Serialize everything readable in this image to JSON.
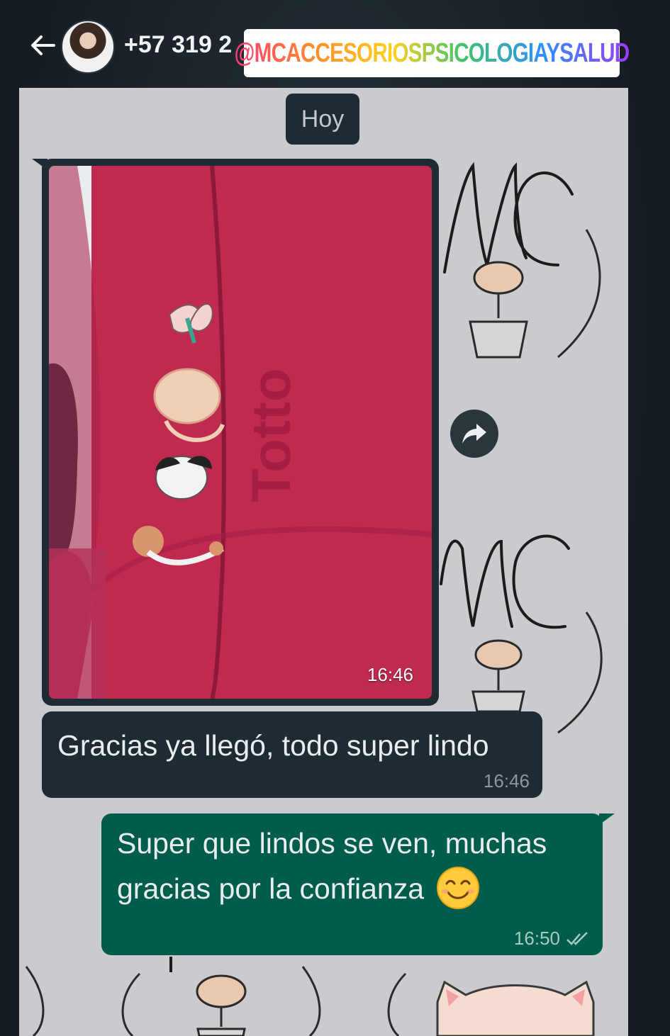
{
  "header": {
    "contact_name": "+57 319 2",
    "instagram_handle": "@MCACCESORIOSPSICOLOGIAYSALUD",
    "back_icon": "arrow-left-icon",
    "avatar_icon": "profile-avatar"
  },
  "chat": {
    "date_chip": "Hoy",
    "messages": [
      {
        "type": "image",
        "direction": "incoming",
        "time": "16:46",
        "icon": "photo-pink-backpack-with-pins"
      },
      {
        "type": "text",
        "direction": "incoming",
        "text": "Gracias ya llegó, todo super lindo",
        "time": "16:46"
      },
      {
        "type": "text",
        "direction": "outgoing",
        "text": "Super que lindos se ven, muchas gracias por la confianza",
        "emoji": "smiling-face-icon",
        "time": "16:50",
        "status_icon": "double-check-icon"
      }
    ],
    "forward_icon": "forward-share-icon",
    "wallpaper_text": "MC"
  },
  "colors": {
    "incoming_bubble": "#1f2b32",
    "outgoing_bubble": "#005c4b",
    "chat_background": "#c9cbce"
  }
}
